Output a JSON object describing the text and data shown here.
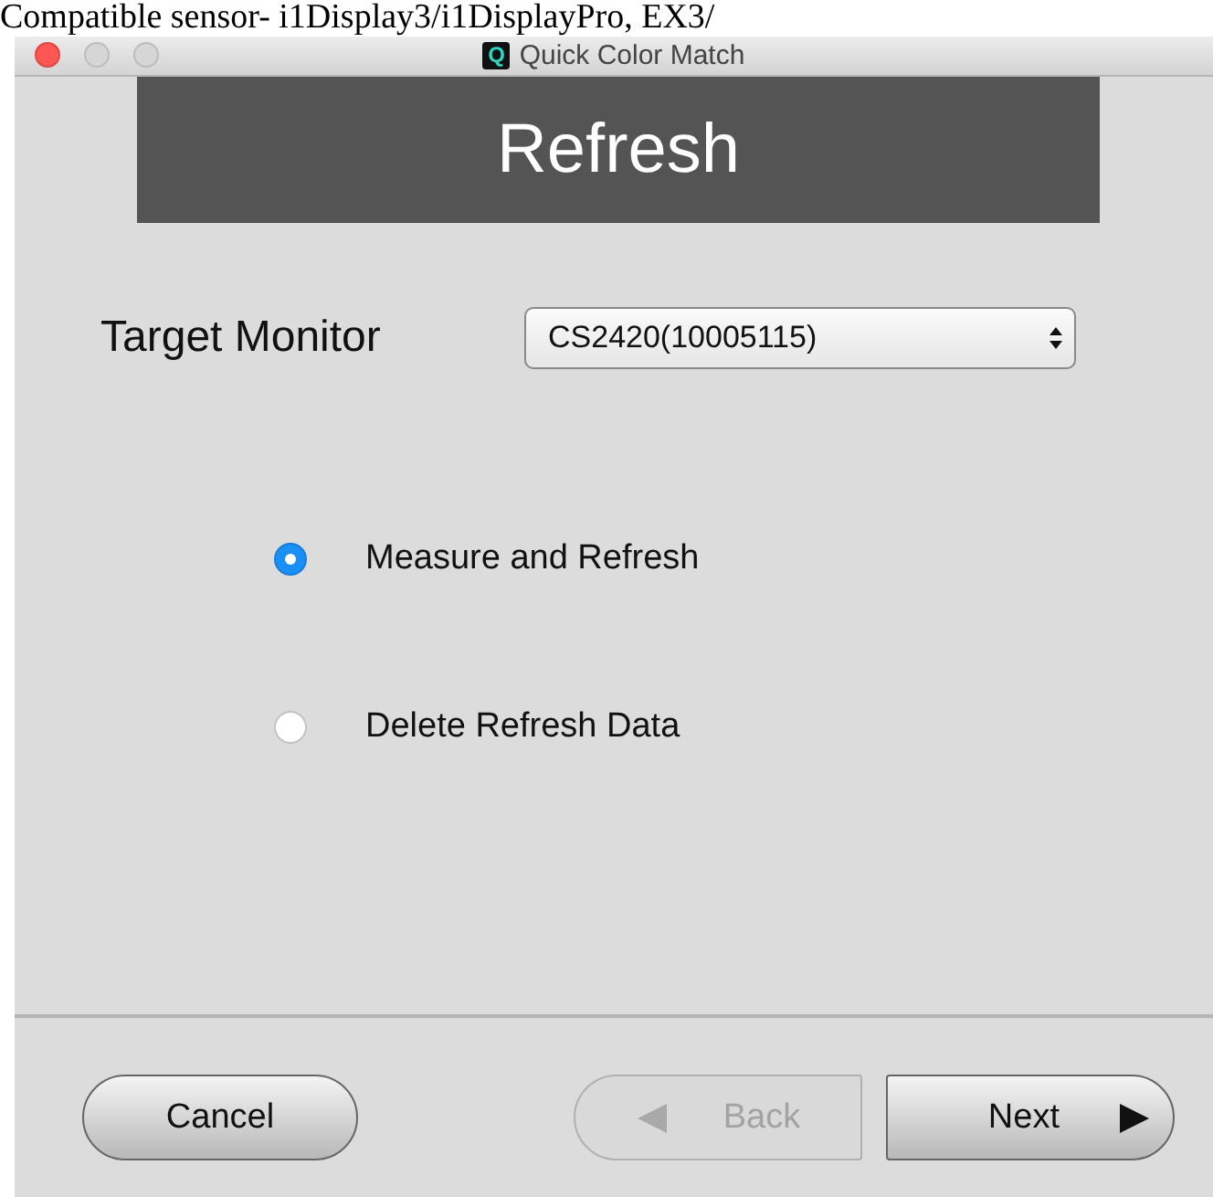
{
  "page_caption": "Compatible sensor- i1Display3/i1DisplayPro, EX3/",
  "window": {
    "title": "Quick Color Match",
    "app_icon_letter": "Q"
  },
  "header": {
    "title": "Refresh"
  },
  "target_monitor": {
    "label": "Target Monitor",
    "value": "CS2420(10005115)"
  },
  "options": [
    {
      "label": "Measure and Refresh",
      "selected": true
    },
    {
      "label": "Delete Refresh Data",
      "selected": false
    }
  ],
  "buttons": [
    {
      "label": "Cancel",
      "kind": "cancel",
      "disabled": false
    },
    {
      "label": "Back",
      "kind": "back",
      "disabled": true
    },
    {
      "label": "Next",
      "kind": "next",
      "disabled": false
    }
  ]
}
